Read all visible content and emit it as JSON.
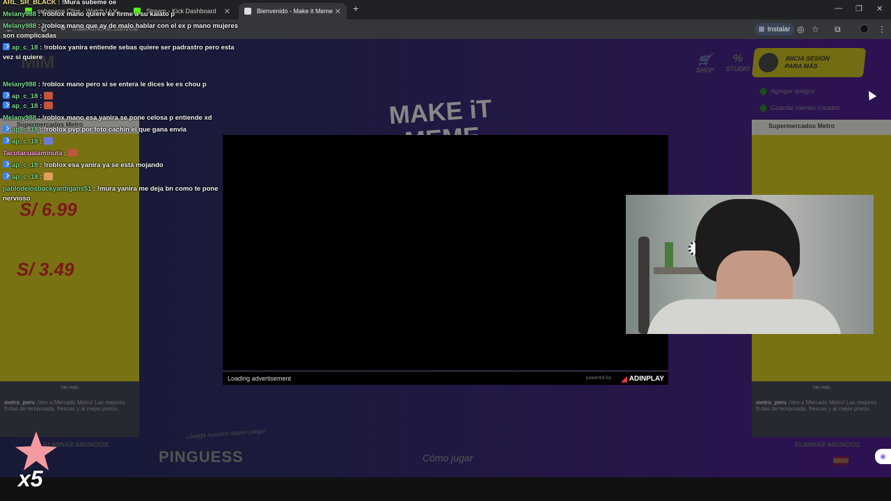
{
  "browser": {
    "tabs": [
      {
        "label": "sebanana Clips - Watch Live c..."
      },
      {
        "label": "Stream - Kick Dashboard"
      },
      {
        "label": "Bienvenido - Make it Meme"
      }
    ],
    "new_tab": "+",
    "url": "makeitmeme.com/es/",
    "install_label": "Instalar"
  },
  "page": {
    "logo_small": "MIM",
    "logo_main_line1": "MAKE iT",
    "logo_main_line2": "MEME",
    "nav": [
      {
        "label": "SHOP",
        "icon": "cart-icon"
      },
      {
        "label": "STUDIO",
        "icon": "percent-icon"
      }
    ],
    "login_label_line1": "INICIA SESIÓN",
    "login_label_line2": "PARA MÁS",
    "side_links": [
      "Agregar amigos",
      "Guardar memes creados"
    ],
    "ad_left": {
      "advertiser": "Supermercados Metro",
      "price1": "6.99",
      "price2": "3.49",
      "ver_mas": "Ver más",
      "footer_user": "metro_peru",
      "footer_text": "¡Ven a Mercado Metro! Las mejores frutas de temporada, frescas y al mejor precio."
    },
    "ad_right": {
      "advertiser": "Supermercados Metro",
      "ver_mas": "Ver más",
      "footer_user": "metro_peru",
      "footer_text": "¡Ven a Mercado Metro! Las mejores frutas de temporada, frescas y al mejor precio."
    },
    "eliminar_left": "ELIMINAR ANUNCIOS",
    "eliminar_right": "ELIMINAR ANUNCIOS",
    "pinguess": "PINGUESS",
    "pinguess_sub": "¡Juega nuestro nuevo juego!",
    "como_jugar": "Cómo jugar"
  },
  "ad": {
    "loading": "Loading advertisement",
    "powered_by": "powered by",
    "brand": "ADINPLAY"
  },
  "chat": [
    {
      "user": "ARL_SR_BLACK",
      "text": "!Mura subeme oe",
      "badge": false,
      "color": "yellow"
    },
    {
      "user": "Melany988",
      "text": "!roblox mano quiere ke firme a su kalato p",
      "badge": false,
      "color": "green"
    },
    {
      "user": "Melany988",
      "text": "!roblox mano que ay de malo hablar con el ex p mano mujeres son complicadas",
      "badge": false,
      "color": "green"
    },
    {
      "user": "ap_c_18",
      "text": "!roblox yanira entiende sebas quiere ser padrastro pero esta vez si quiere",
      "badge": true,
      "color": "green"
    },
    {
      "user": "Melany988",
      "text": "!roblox mano pero si se entera le dices ke es chou p",
      "badge": false,
      "color": "green"
    },
    {
      "user": "ap_c_18",
      "text": "",
      "badge": true,
      "color": "green",
      "emote": "#c2553a"
    },
    {
      "user": "ap_c_18",
      "text": "",
      "badge": true,
      "color": "green",
      "emote": "#c2553a"
    },
    {
      "user": "Melany988",
      "text": "!roblox mano esa yanira se pone celosa p entiende xd",
      "badge": false,
      "color": "green"
    },
    {
      "user": "ap_c_18",
      "text": "!roblox pvp por foto cachin el que gana envía",
      "badge": true,
      "color": "green"
    },
    {
      "user": "ap_c_18",
      "text": "",
      "badge": true,
      "color": "green",
      "emote": "#6b7bd6"
    },
    {
      "user": "Tacutacualaminuta",
      "text": "",
      "badge": false,
      "color": "pink",
      "emote": "#c2553a"
    },
    {
      "user": "ap_c_18",
      "text": "!roblox esa yanira ya se está mojando",
      "badge": true,
      "color": "green"
    },
    {
      "user": "ap_c_18",
      "text": "",
      "badge": true,
      "color": "green",
      "emote": "#e0a060"
    },
    {
      "user": "pablodelosbackyardigans51",
      "text": "!mura yanira me deja bn como te pone nervioso",
      "badge": false,
      "color": "green"
    }
  ],
  "overlay": {
    "multiplier": "x5"
  }
}
